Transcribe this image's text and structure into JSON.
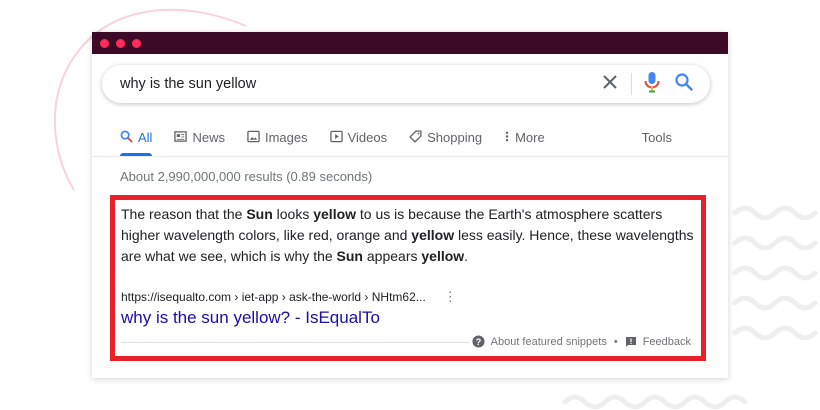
{
  "search": {
    "query": "why is the sun yellow"
  },
  "tabs": [
    {
      "label": "All",
      "icon": "search-icon",
      "active": true
    },
    {
      "label": "News",
      "icon": "news-icon"
    },
    {
      "label": "Images",
      "icon": "image-icon"
    },
    {
      "label": "Videos",
      "icon": "video-icon"
    },
    {
      "label": "Shopping",
      "icon": "shopping-tag-icon"
    },
    {
      "label": "More",
      "icon": "kebab-icon"
    }
  ],
  "tools_label": "Tools",
  "result_stats": "About 2,990,000,000 results (0.89 seconds)",
  "snippet": {
    "parts": [
      {
        "text": "The reason that the ",
        "bold": false
      },
      {
        "text": "Sun",
        "bold": true
      },
      {
        "text": " looks ",
        "bold": false
      },
      {
        "text": "yellow",
        "bold": true
      },
      {
        "text": " to us is because the Earth's atmosphere scatters higher wavelength colors, like red, orange and ",
        "bold": false
      },
      {
        "text": "yellow",
        "bold": true
      },
      {
        "text": " less easily. Hence, these wavelengths are what we see, which is why the ",
        "bold": false
      },
      {
        "text": "Sun",
        "bold": true
      },
      {
        "text": " appears ",
        "bold": false
      },
      {
        "text": "yellow",
        "bold": true
      },
      {
        "text": ".",
        "bold": false
      }
    ],
    "cite": "https://isequalto.com › iet-app › ask-the-world › NHtm62...",
    "kebab": "⋮",
    "title": "why is the sun yellow? - IsEqualTo",
    "about_label": "About featured snippets",
    "separator": "•",
    "feedback_label": "Feedback"
  },
  "colors": {
    "titlebar": "#3d0a26",
    "window_dots": "#ff2b5d",
    "highlight_border": "#e8202a",
    "link": "#1a0dab",
    "active_tab": "#1a73e8"
  }
}
